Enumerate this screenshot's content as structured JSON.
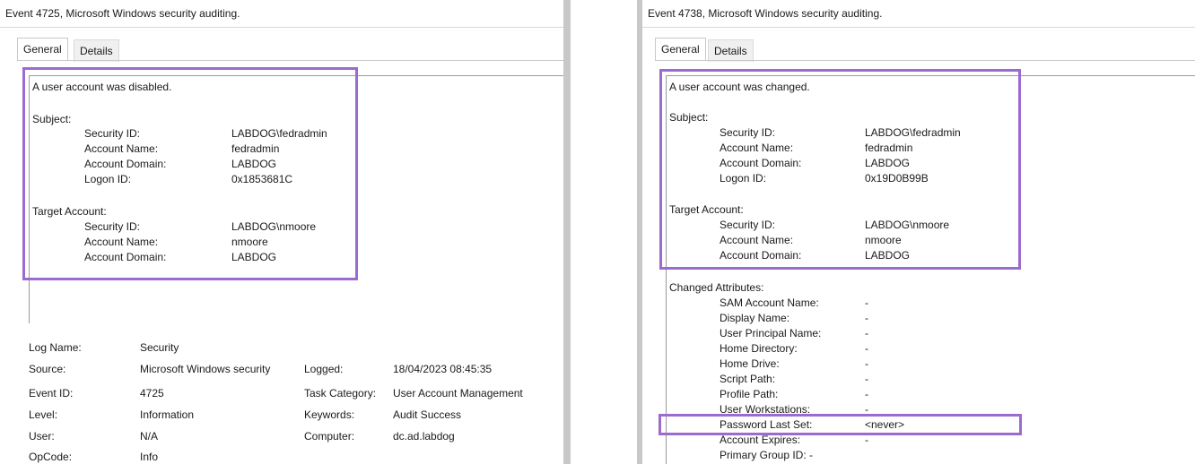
{
  "left": {
    "window_title": "Event 4725, Microsoft Windows security auditing.",
    "tabs": [
      "General",
      "Details"
    ],
    "description": "A user account was disabled.",
    "subject": {
      "heading": "Subject:",
      "rows": [
        {
          "label": "Security ID:",
          "value": "LABDOG\\fedradmin"
        },
        {
          "label": "Account Name:",
          "value": "fedradmin"
        },
        {
          "label": "Account Domain:",
          "value": "LABDOG"
        },
        {
          "label": "Logon ID:",
          "value": "0x1853681C"
        }
      ]
    },
    "target": {
      "heading": "Target Account:",
      "rows": [
        {
          "label": "Security ID:",
          "value": "LABDOG\\nmoore"
        },
        {
          "label": "Account Name:",
          "value": "nmoore"
        },
        {
          "label": "Account Domain:",
          "value": "LABDOG"
        }
      ]
    },
    "info": {
      "log_name_label": "Log Name:",
      "log_name": "Security",
      "source_label": "Source:",
      "source": "Microsoft Windows security",
      "logged_label": "Logged:",
      "logged": "18/04/2023 08:45:35",
      "event_id_label": "Event ID:",
      "event_id": "4725",
      "task_category_label": "Task Category:",
      "task_category": "User Account Management",
      "level_label": "Level:",
      "level": "Information",
      "keywords_label": "Keywords:",
      "keywords": "Audit Success",
      "user_label": "User:",
      "user": "N/A",
      "computer_label": "Computer:",
      "computer": "dc.ad.labdog",
      "opcode_label": "OpCode:",
      "opcode": "Info"
    }
  },
  "right": {
    "window_title": "Event 4738, Microsoft Windows security auditing.",
    "tabs": [
      "General",
      "Details"
    ],
    "description": "A user account was changed.",
    "subject": {
      "heading": "Subject:",
      "rows": [
        {
          "label": "Security ID:",
          "value": "LABDOG\\fedradmin"
        },
        {
          "label": "Account Name:",
          "value": "fedradmin"
        },
        {
          "label": "Account Domain:",
          "value": "LABDOG"
        },
        {
          "label": "Logon ID:",
          "value": "0x19D0B99B"
        }
      ]
    },
    "target": {
      "heading": "Target Account:",
      "rows": [
        {
          "label": "Security ID:",
          "value": "LABDOG\\nmoore"
        },
        {
          "label": "Account Name:",
          "value": "nmoore"
        },
        {
          "label": "Account Domain:",
          "value": "LABDOG"
        }
      ]
    },
    "changed": {
      "heading": "Changed Attributes:",
      "rows": [
        {
          "label": "SAM Account Name:",
          "value": "-"
        },
        {
          "label": "Display Name:",
          "value": "-"
        },
        {
          "label": "User Principal Name:",
          "value": "-"
        },
        {
          "label": "Home Directory:",
          "value": "-"
        },
        {
          "label": "Home Drive:",
          "value": "-"
        },
        {
          "label": "Script Path:",
          "value": "-"
        },
        {
          "label": "Profile Path:",
          "value": "-"
        },
        {
          "label": "User Workstations:",
          "value": "-"
        },
        {
          "label": "Password Last Set:",
          "value": "<never>"
        },
        {
          "label": "Account Expires:",
          "value": "-"
        }
      ],
      "primary_group": "Primary Group ID: -"
    }
  },
  "colors": {
    "highlight": "#9b6bd1",
    "divider": "#c8c8c8"
  }
}
